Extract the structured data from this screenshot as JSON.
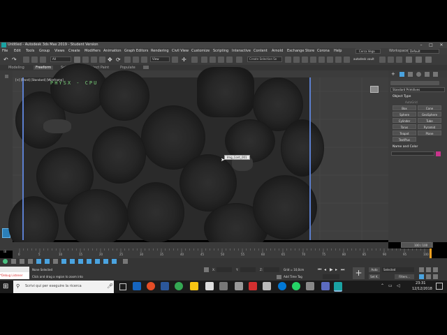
{
  "window": {
    "title": "Untitled - Autodesk 3ds Max 2019 - Student Version"
  },
  "menu": {
    "items": [
      "File",
      "Edit",
      "Tools",
      "Group",
      "Views",
      "Create",
      "Modifiers",
      "Animation",
      "Graph Editors",
      "Rendering",
      "Civil View",
      "Customize",
      "Scripting",
      "Interactive",
      "Content",
      "Arnold",
      "Exchange Store",
      "Corona",
      "Help"
    ],
    "search": "Cerca Vega",
    "workspaces_label": "Workspaces:",
    "workspace_value": "Default"
  },
  "toolbar": {
    "selection_filter": "All",
    "view_label": "View",
    "named_selection": "Create Selection Se",
    "autodesk_label": "autodesk vault"
  },
  "ribbon": {
    "tabs": [
      "Modeling",
      "Freeform",
      "Selection",
      "Object Paint",
      "Populate"
    ]
  },
  "viewport": {
    "label": "[+] [Front] [Standard] [Wireframe]",
    "overlay_text": "PHYSX - CPU",
    "tooltip": "Img_Cont_001"
  },
  "command_panel": {
    "dropdown": "Standard Primitives",
    "rollout_object_type": "Object Type",
    "autogrid": "AutoGrid",
    "buttons": [
      "Box",
      "Cone",
      "Sphere",
      "GeoSphere",
      "Cylinder",
      "Tube",
      "Torus",
      "Pyramid",
      "Teapot",
      "Plane",
      "TextPlus"
    ],
    "rollout_name_color": "Name and Color",
    "color_swatch": "#c8348c"
  },
  "timeline": {
    "frame_display": "100 / 100",
    "ticks": [
      "0",
      "5",
      "10",
      "15",
      "20",
      "25",
      "30",
      "35",
      "40",
      "45",
      "50",
      "55",
      "60",
      "65",
      "70",
      "75",
      "80",
      "85",
      "90",
      "95",
      "100"
    ]
  },
  "status": {
    "selection": "None Selected",
    "prompt": "Click and drag a region to zoom into",
    "x_label": "X:",
    "y_label": "Y:",
    "z_label": "Z:",
    "grid": "Grid = 10,0cm",
    "add_time_tag": "Add Time Tag",
    "auto_label": "Auto",
    "selected_label": "Selected",
    "setk_label": "Set K.",
    "filters_label": "Filters...",
    "listener": "*Debug Listener"
  },
  "taskbar": {
    "search_placeholder": "Scrivi qui per eseguire la ricerca",
    "time": "23:31",
    "date": "12/12/2018"
  }
}
